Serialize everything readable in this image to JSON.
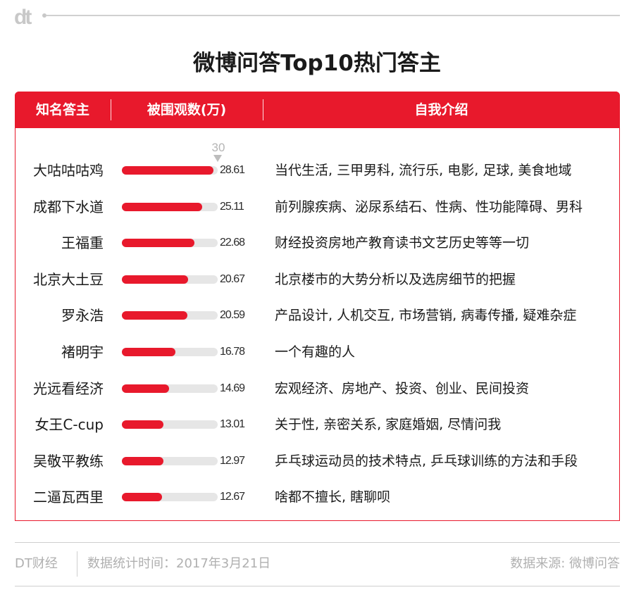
{
  "brand": {
    "logo_text": "dt"
  },
  "title": "微博问答Top10热门答主",
  "columns": {
    "name": "知名答主",
    "views": "被围观数(万)",
    "intro": "自我介绍"
  },
  "colors": {
    "accent": "#e8192c",
    "track": "#e6e6e6",
    "muted": "#b0b0b0"
  },
  "chart_data": {
    "type": "bar",
    "orientation": "horizontal",
    "title": "微博问答Top10热门答主",
    "xlim": [
      0,
      30
    ],
    "reference_tick": "30",
    "categories": [
      "大咕咕咕鸡",
      "成都下水道",
      "王福重",
      "北京大土豆",
      "罗永浩",
      "褚明宇",
      "光远看经济",
      "女王C-cup",
      "吴敬平教练",
      "二逼瓦西里"
    ],
    "values": [
      28.61,
      25.11,
      22.68,
      20.67,
      20.59,
      16.78,
      14.69,
      13.01,
      12.97,
      12.67
    ],
    "value_labels": [
      "28.61",
      "25.11",
      "22.68",
      "20.67",
      "20.59",
      "16.78",
      "14.69",
      "13.01",
      "12.97",
      "12.67"
    ],
    "rows": [
      {
        "name": "大咕咕咕鸡",
        "value": 28.61,
        "value_label": "28.61",
        "intro": "当代生活, 三甲男科, 流行乐, 电影, 足球, 美食地域"
      },
      {
        "name": "成都下水道",
        "value": 25.11,
        "value_label": "25.11",
        "intro": "前列腺疾病、泌尿系结石、性病、性功能障碍、男科"
      },
      {
        "name": "王福重",
        "value": 22.68,
        "value_label": "22.68",
        "intro": "财经投资房地产教育读书文艺历史等等一切"
      },
      {
        "name": "北京大土豆",
        "value": 20.67,
        "value_label": "20.67",
        "intro": "北京楼市的大势分析以及选房细节的把握"
      },
      {
        "name": "罗永浩",
        "value": 20.59,
        "value_label": "20.59",
        "intro": "产品设计, 人机交互, 市场营销, 病毒传播, 疑难杂症"
      },
      {
        "name": "褚明宇",
        "value": 16.78,
        "value_label": "16.78",
        "intro": "一个有趣的人"
      },
      {
        "name": "光远看经济",
        "value": 14.69,
        "value_label": "14.69",
        "intro": "宏观经济、房地产、投资、创业、民间投资"
      },
      {
        "name": "女王C-cup",
        "value": 13.01,
        "value_label": "13.01",
        "intro": "关于性, 亲密关系, 家庭婚姻, 尽情问我"
      },
      {
        "name": "吴敬平教练",
        "value": 12.97,
        "value_label": "12.97",
        "intro": "乒乓球运动员的技术特点, 乒乓球训练的方法和手段"
      },
      {
        "name": "二逼瓦西里",
        "value": 12.67,
        "value_label": "12.67",
        "intro": "啥都不擅长, 瞎聊呗"
      }
    ]
  },
  "footer": {
    "brand": "DT财经",
    "date": "数据统计时间：2017年3月21日",
    "source": "数据来源: 微博问答"
  }
}
